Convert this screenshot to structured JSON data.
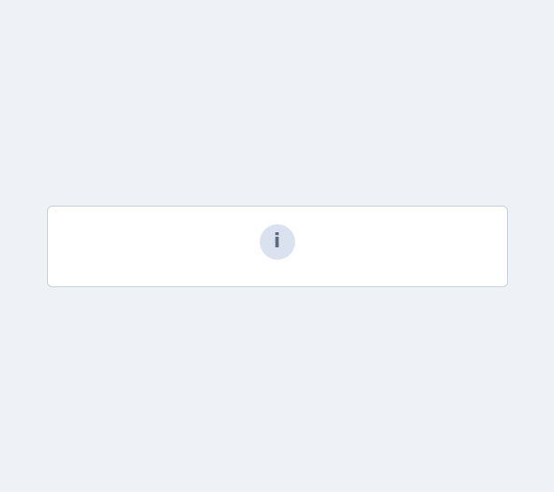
{
  "notice": {
    "message": ""
  }
}
